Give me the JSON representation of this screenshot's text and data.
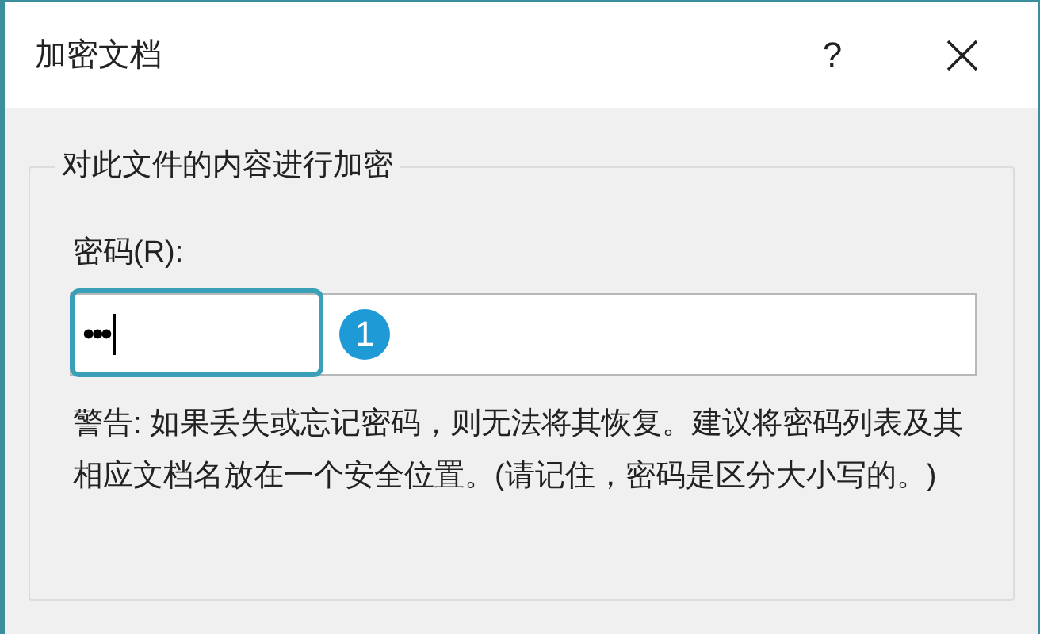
{
  "window": {
    "title": "加密文档",
    "help_button": "?"
  },
  "group": {
    "title": "对此文件的内容进行加密",
    "password_label": "密码(R):",
    "password_field": {
      "value": "•••",
      "focused": true
    },
    "warning": "警告: 如果丢失或忘记密码，则无法将其恢复。建议将密码列表及其相应文档名放在一个安全位置。(请记住，密码是区分大小写的。)"
  },
  "callout": {
    "number": "1"
  }
}
